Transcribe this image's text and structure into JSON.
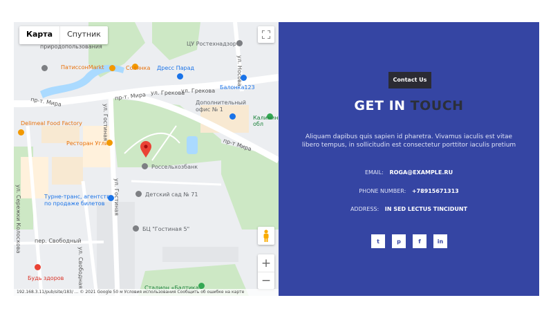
{
  "map": {
    "type_tabs": [
      "Карта",
      "Спутник"
    ],
    "active_tab": "Карта",
    "zoom_in": "+",
    "zoom_out": "−",
    "labels": {
      "nature_use": "природопользования",
      "rostekhnadzor": "ЦУ Ростехнадзор",
      "patisson": "ПатиссонMarkt",
      "solyanka": "Солянка",
      "dress": "Дресс Парад",
      "balonka": "Балонка123",
      "prospect_mira_1": "пр-т. Мира",
      "prospect_mira_2": "пр-т. Мира",
      "prospect_mira_3": "пр-т Мира",
      "grekova_1": "ул. Грекова",
      "grekova_2": "ул. Грекова",
      "nosova": "ул. Носова",
      "office": "Дополнительный офис № 1",
      "kaliningrad": "Калинин обл",
      "delimeal": "Delimeal Food Factory",
      "ugli": "Ресторан Угли",
      "rosselkhoz": "Россельхозбанк",
      "gostinaya_1": "ул. Гостиная",
      "gostinaya_2": "ул. Гостиная",
      "seryozhka": "ул. Сережки Колоскова",
      "turne": "Турне-транс, агентство по продаже билетов",
      "kindergarten": "Детский сад № 71",
      "bc": "БЦ \"Гостиная 5\"",
      "svobodny": "пер. Свободный",
      "svobodnaya": "ул. Свободная",
      "bud_zdorov": "Будь здоров",
      "stadium": "Стадион «Балтика»"
    },
    "footer": "192.168.3.11/pub/site/183/ ... © 2021 Google   50 м   Условия использования   Сообщить об ошибке на карте"
  },
  "contact": {
    "badge": "Contact Us",
    "heading_1": "GET IN",
    "heading_2": "TOUCH",
    "description": "Aliquam dapibus quis sapien id pharetra. Vivamus iaculis est vitae libero tempus, in sollicitudin est consectetur porttitor iaculis pretium",
    "email_label": "EMAIL:",
    "email_value": "ROGA@EXAMPLE.RU",
    "phone_label": "PHONE NUMBER:",
    "phone_value": "+78915671313",
    "address_label": "ADDRESS:",
    "address_value": "IN SED LECTUS TINCIDUNT",
    "socials": [
      "twitter-icon",
      "pinterest-icon",
      "facebook-icon",
      "linkedin-icon"
    ],
    "social_glyphs": [
      "t",
      "p",
      "f",
      "in"
    ]
  },
  "colors": {
    "panel": "#3545a3",
    "badge": "#2b2b33",
    "heading_accent": "#2b2f3a"
  }
}
